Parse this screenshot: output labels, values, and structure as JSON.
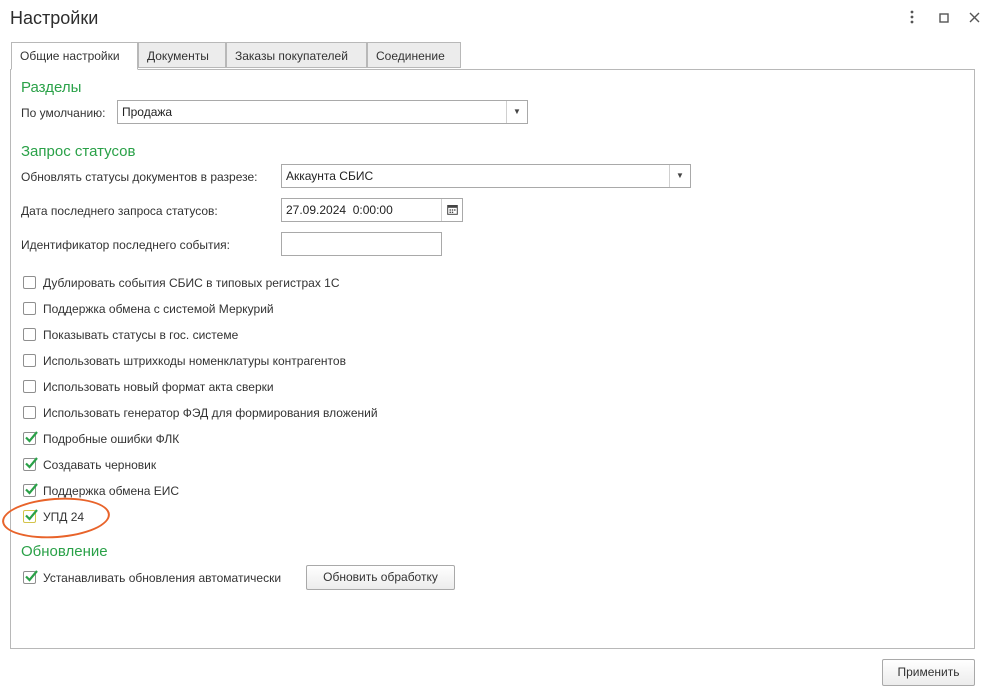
{
  "window": {
    "title": "Настройки",
    "menu_icon": "kebab-menu-icon",
    "maximize_icon": "maximize-icon",
    "close_icon": "close-icon"
  },
  "tabs": [
    {
      "label": "Общие настройки",
      "active": true
    },
    {
      "label": "Документы",
      "active": false
    },
    {
      "label": "Заказы покупателей",
      "active": false
    },
    {
      "label": "Соединение",
      "active": false
    }
  ],
  "sections": {
    "razdely": {
      "title": "Разделы",
      "default_label": "По умолчанию:",
      "default_value": "Продажа"
    },
    "status_request": {
      "title": "Запрос статусов",
      "update_by_label": "Обновлять статусы документов в разрезе:",
      "update_by_value": "Аккаунта СБИС",
      "last_request_label": "Дата последнего запроса статусов:",
      "last_request_value": "27.09.2024  0:00:00",
      "last_event_label": "Идентификатор последнего события:",
      "last_event_value": ""
    },
    "checkboxes": [
      {
        "label": "Дублировать события СБИС в типовых регистрах 1С",
        "checked": false
      },
      {
        "label": "Поддержка обмена с системой Меркурий",
        "checked": false
      },
      {
        "label": "Показывать статусы в гос. системе",
        "checked": false
      },
      {
        "label": "Использовать штрихкоды номенклатуры контрагентов",
        "checked": false
      },
      {
        "label": "Использовать новый формат акта сверки",
        "checked": false
      },
      {
        "label": "Использовать генератор ФЭД для формирования вложений",
        "checked": false
      },
      {
        "label": "Подробные ошибки ФЛК",
        "checked": true
      },
      {
        "label": "Создавать черновик",
        "checked": true
      },
      {
        "label": "Поддержка обмена ЕИС",
        "checked": true
      },
      {
        "label": "УПД 24",
        "checked": true
      }
    ],
    "update": {
      "title": "Обновление",
      "auto_update_label": "Устанавливать обновления автоматически",
      "auto_update_checked": true,
      "update_button": "Обновить обработку"
    }
  },
  "footer": {
    "apply_button": "Применить"
  },
  "colors": {
    "section_title": "#2aa148",
    "check": "#2aa148",
    "highlight": "#e8632a"
  }
}
